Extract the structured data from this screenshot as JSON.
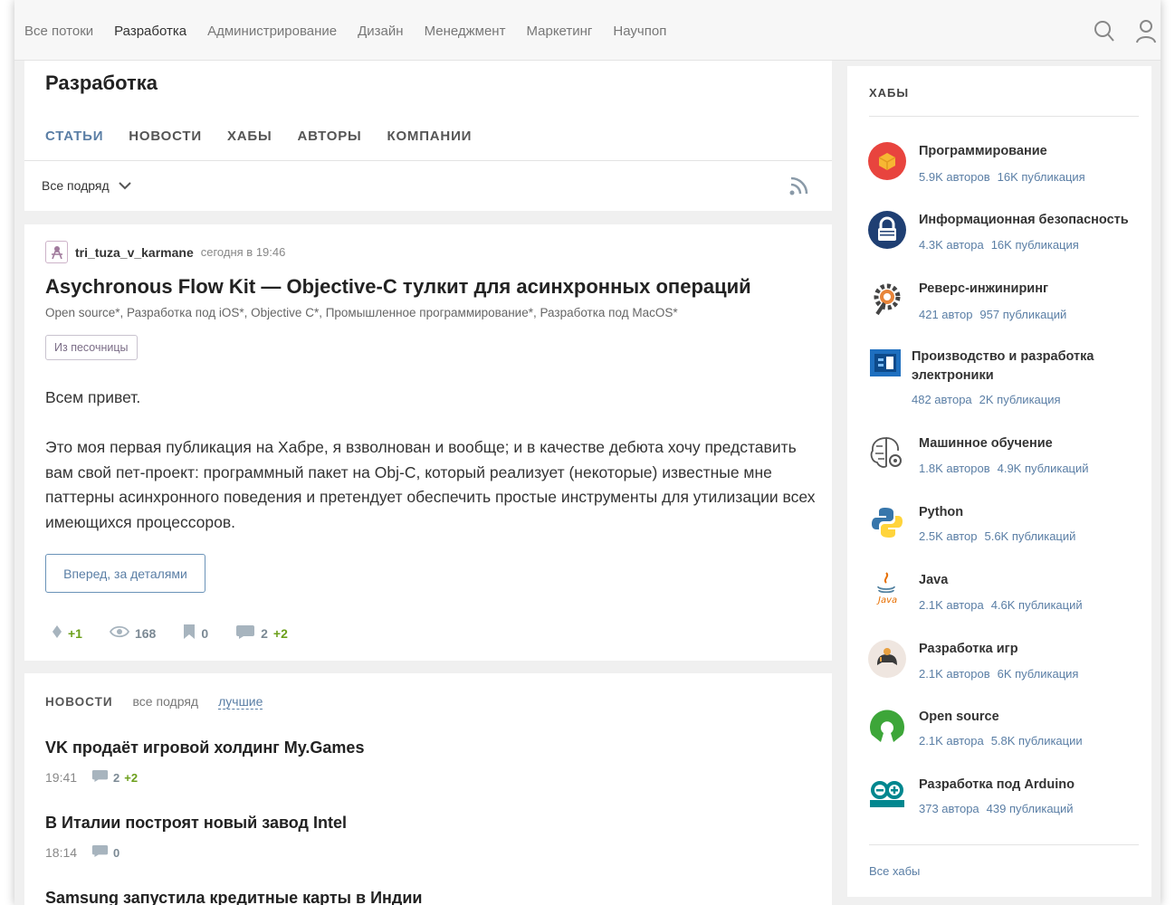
{
  "nav": {
    "flows": [
      "Все потоки",
      "Разработка",
      "Администрирование",
      "Дизайн",
      "Менеджмент",
      "Маркетинг",
      "Научпоп"
    ],
    "active_flow": "Разработка",
    "icons": [
      "search-icon",
      "user-icon"
    ]
  },
  "hub_page": {
    "title": "Разработка",
    "tabs": [
      "СТАТЬИ",
      "НОВОСТИ",
      "ХАБЫ",
      "АВТОРЫ",
      "КОМПАНИИ"
    ],
    "active_tab": "СТАТЬИ",
    "filter_label": "Все подряд"
  },
  "post": {
    "author": "tri_tuza_v_karmane",
    "time": "сегодня в 19:46",
    "title": "Asychronous Flow Kit — Objective-C тулкит для асинхронных операций",
    "hubs": "Open source*, Разработка под iOS*, Objective C*, Промышленное программирование*, Разработка под MacOS*",
    "badge": "Из песочницы",
    "greeting": "Всем привет.",
    "paragraph": "Это моя первая публикация на Хабре, я взволнован и вообще; и в качестве дебюта хочу представить вам свой пет-проект: программный пакет на Obj-C, который реализует (некоторые) известные мне паттерны асинхронного поведения и претендует обеспечить простые инструменты для утилизации всех имеющихся процессоров.",
    "more_button": "Вперед, за деталями",
    "rating": "+1",
    "views": "168",
    "bookmarks": "0",
    "comments": "2",
    "new_comments": "+2"
  },
  "news": {
    "label": "НОВОСТИ",
    "options": [
      "все подряд",
      "лучшие"
    ],
    "active_option": "лучшие",
    "items": [
      {
        "title": "VK продаёт игровой холдинг My.Games",
        "time": "19:41",
        "comments": "2",
        "new_comments": "+2"
      },
      {
        "title": "В Италии построят новый завод Intel",
        "time": "18:14",
        "comments": "0",
        "new_comments": ""
      },
      {
        "title": "Samsung запустила кредитные карты в Индии",
        "time": "",
        "comments": "",
        "new_comments": ""
      }
    ]
  },
  "sidebar": {
    "heading": "ХАБЫ",
    "hubs": [
      {
        "name": "Программирование",
        "authors": "5.9K авторов",
        "posts": "16K публикация",
        "icon": "programming-icon"
      },
      {
        "name": "Информационная безопасность",
        "authors": "4.3K автора",
        "posts": "16K публикация",
        "icon": "lock-icon"
      },
      {
        "name": "Реверс-инжиниринг",
        "authors": "421 автор",
        "posts": "957 публикаций",
        "icon": "gear-wrench-icon"
      },
      {
        "name": "Производство и разработка электроники",
        "authors": "482 автора",
        "posts": "2K публикация",
        "icon": "electronics-icon"
      },
      {
        "name": "Машинное обучение",
        "authors": "1.8K авторов",
        "posts": "4.9K публикаций",
        "icon": "brain-icon"
      },
      {
        "name": "Python",
        "authors": "2.5K автор",
        "posts": "5.6K публикаций",
        "icon": "python-icon"
      },
      {
        "name": "Java",
        "authors": "2.1K автора",
        "posts": "4.6K публикаций",
        "icon": "java-icon"
      },
      {
        "name": "Разработка игр",
        "authors": "2.1K авторов",
        "posts": "6K публикация",
        "icon": "gamepad-icon"
      },
      {
        "name": "Open source",
        "authors": "2.1K автора",
        "posts": "5.8K публикации",
        "icon": "open-source-icon"
      },
      {
        "name": "Разработка под Arduino",
        "authors": "373 автора",
        "posts": "439 публикаций",
        "icon": "arduino-icon"
      }
    ],
    "all_link": "Все хабы"
  },
  "colors": {
    "accent": "#5a7ea5",
    "positive": "#6b9f1a",
    "background": "#f0f0f0"
  }
}
